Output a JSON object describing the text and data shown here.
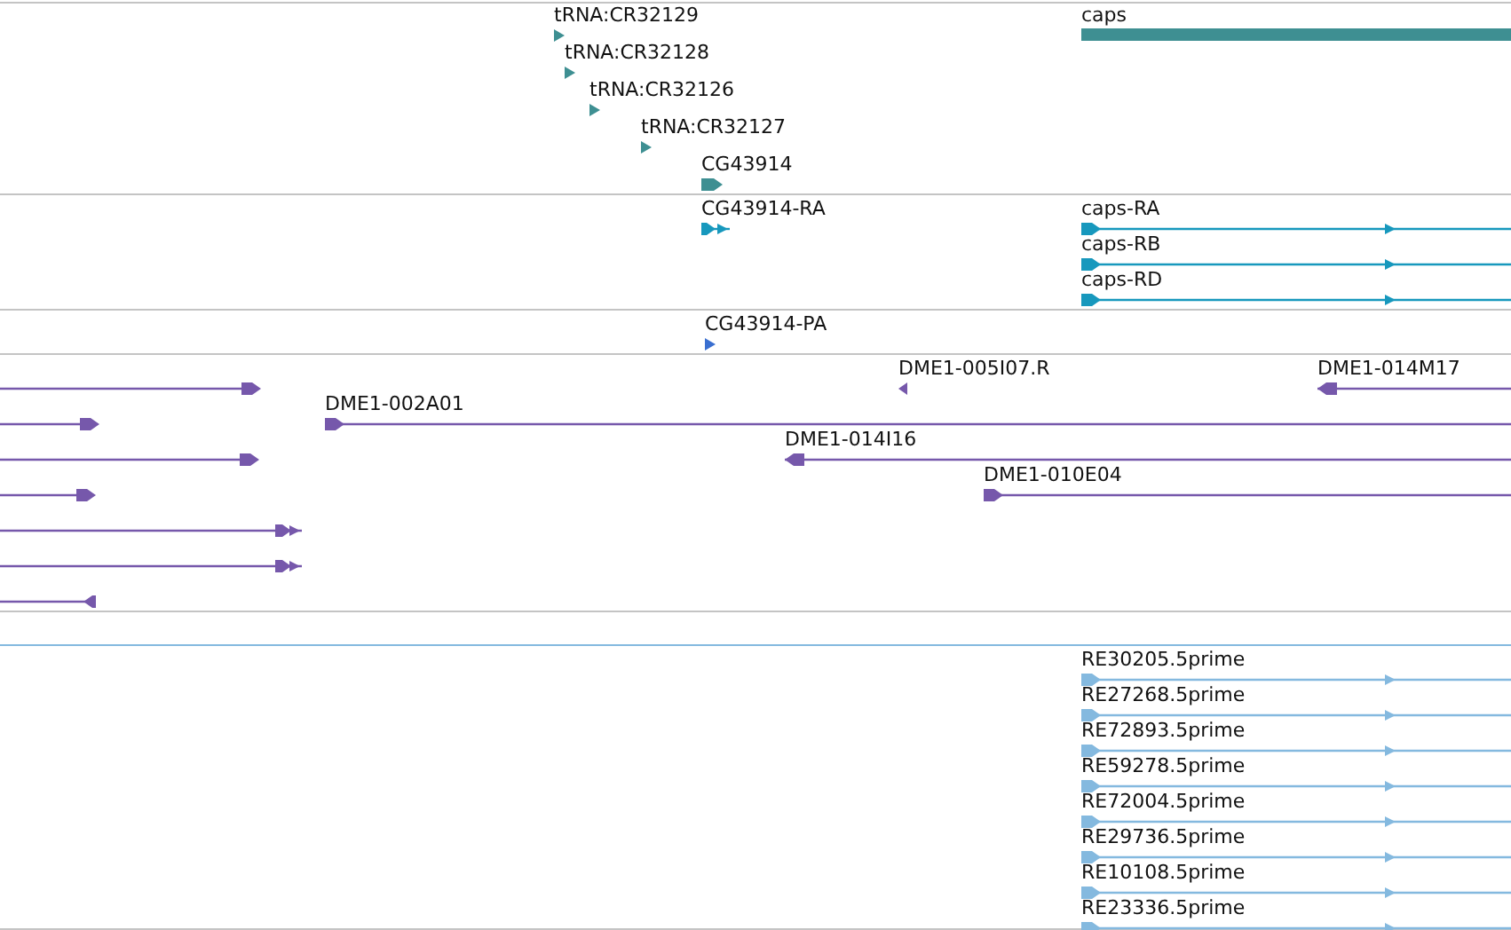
{
  "tracks": [
    {
      "color": "#3e8f92",
      "features": [
        {
          "label": "tRNA:CR32129",
          "kind": "tick-right"
        },
        {
          "label": "tRNA:CR32128",
          "kind": "tick-right"
        },
        {
          "label": "tRNA:CR32126",
          "kind": "tick-right"
        },
        {
          "label": "tRNA:CR32127",
          "kind": "tick-right"
        },
        {
          "label": "CG43914",
          "kind": "block-right"
        },
        {
          "label": "caps",
          "kind": "bar"
        }
      ]
    },
    {
      "color": "#1798bd",
      "features": [
        {
          "label": "CG43914-RA",
          "kind": "double-short"
        },
        {
          "label": "caps-RA",
          "kind": "transcript"
        },
        {
          "label": "caps-RB",
          "kind": "transcript"
        },
        {
          "label": "caps-RD",
          "kind": "transcript"
        }
      ]
    },
    {
      "color": "#3a6fd0",
      "features": [
        {
          "label": "CG43914-PA",
          "kind": "tick-right"
        }
      ]
    },
    {
      "color": "#7658ab",
      "features": [
        {
          "kind": "end-right"
        },
        {
          "label": "DME1-005I07.R",
          "kind": "tick-left"
        },
        {
          "label": "DME1-014M17",
          "kind": "start-left"
        },
        {
          "kind": "end-right"
        },
        {
          "label": "DME1-002A01",
          "kind": "start-right"
        },
        {
          "kind": "end-right"
        },
        {
          "label": "DME1-014I16",
          "kind": "start-left"
        },
        {
          "kind": "end-right"
        },
        {
          "label": "DME1-010E04",
          "kind": "start-right"
        },
        {
          "kind": "end-double"
        },
        {
          "kind": "end-double"
        },
        {
          "kind": "end-left"
        }
      ]
    },
    {
      "color": "#84b9df",
      "features": [
        {
          "label": "RE30205.5prime",
          "kind": "transcript"
        },
        {
          "label": "RE27268.5prime",
          "kind": "transcript"
        },
        {
          "label": "RE72893.5prime",
          "kind": "transcript"
        },
        {
          "label": "RE59278.5prime",
          "kind": "transcript"
        },
        {
          "label": "RE72004.5prime",
          "kind": "transcript"
        },
        {
          "label": "RE29736.5prime",
          "kind": "transcript"
        },
        {
          "label": "RE10108.5prime",
          "kind": "transcript"
        },
        {
          "label": "RE23336.5prime",
          "kind": "transcript"
        }
      ]
    }
  ]
}
